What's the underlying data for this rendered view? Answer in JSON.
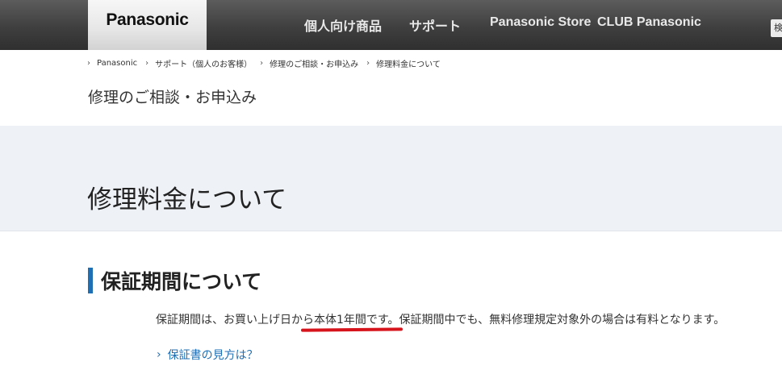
{
  "header": {
    "brand": "Panasonic",
    "nav": [
      {
        "label": "個人向け商品"
      },
      {
        "label": "サポート"
      },
      {
        "label": "Panasonic Store"
      },
      {
        "label": "CLUB Panasonic"
      }
    ],
    "search_stub_text": "検"
  },
  "breadcrumb": {
    "items": [
      {
        "label": "Panasonic"
      },
      {
        "label": "サポート（個人のお客様）"
      },
      {
        "label": "修理のご相談・お申込み"
      },
      {
        "label": "修理料金について"
      }
    ]
  },
  "section": {
    "label": "修理のご相談・お申込み"
  },
  "page": {
    "title": "修理料金について"
  },
  "content": {
    "heading": "保証期間について",
    "text_before": "保証期間は、お買い上げ日か",
    "text_highlight": "ら本体1年間です。",
    "text_after": "保証期間中でも、無料修理規定対象外の場合は有料となります。",
    "link_label": "保証書の見方は？"
  },
  "colors": {
    "header_bg": "#3f3f3f",
    "title_band_bg": "#eef1f6",
    "accent_blue": "#1f6fb5",
    "annotation_red": "#d6141c"
  },
  "icons": [
    "chevron-right-icon"
  ]
}
